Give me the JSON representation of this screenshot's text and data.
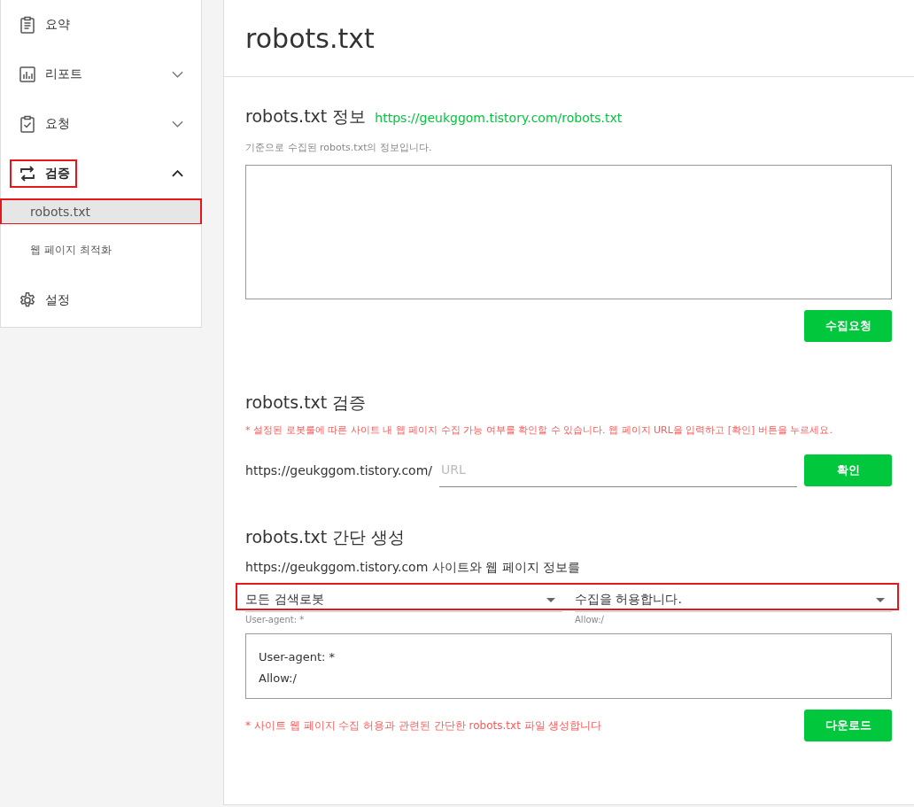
{
  "sidebar": {
    "items": [
      {
        "label": "요약",
        "kind": "link",
        "highlighted": false
      },
      {
        "label": "리포트",
        "kind": "group",
        "expanded": false,
        "highlighted": false
      },
      {
        "label": "요청",
        "kind": "group",
        "expanded": false,
        "highlighted": false
      },
      {
        "label": "검증",
        "kind": "group",
        "expanded": true,
        "highlighted": true,
        "children": [
          {
            "label": "robots.txt",
            "selected": true,
            "highlighted": true
          },
          {
            "label": "웹 페이지 최적화",
            "selected": false,
            "highlighted": false
          }
        ]
      },
      {
        "label": "설정",
        "kind": "link",
        "highlighted": false
      }
    ]
  },
  "page": {
    "title": "robots.txt"
  },
  "info": {
    "heading": "robots.txt 정보",
    "link": "https://geukggom.tistory.com/robots.txt",
    "description": "기준으로 수집된 robots.txt의 정보입니다.",
    "button": "수집요청"
  },
  "verify": {
    "heading": "robots.txt 검증",
    "note": "* 설정된 로봇룰에 따른 사이트 내 웹 페이지 수집 가능 여부를 확인할 수 있습니다. 웹 페이지 URL을 입력하고 [확인] 버튼을 누르세요.",
    "prefix": "https://geukggom.tistory.com/",
    "placeholder": "URL",
    "button": "확인"
  },
  "generate": {
    "heading": "robots.txt 간단 생성",
    "intro": "https://geukggom.tistory.com 사이트와 웹 페이지 정보를",
    "highlighted": true,
    "selects": [
      {
        "value": "모든 검색로봇",
        "caption": "User-agent: *"
      },
      {
        "value": "수집을 허용합니다.",
        "caption": "Allow:/"
      }
    ],
    "output": [
      "User-agent: *",
      "Allow:/"
    ],
    "note": "* 사이트 웹 페이지 수집 허용과 관련된 간단한 robots.txt 파일 생성합니다",
    "button": "다운로드"
  }
}
